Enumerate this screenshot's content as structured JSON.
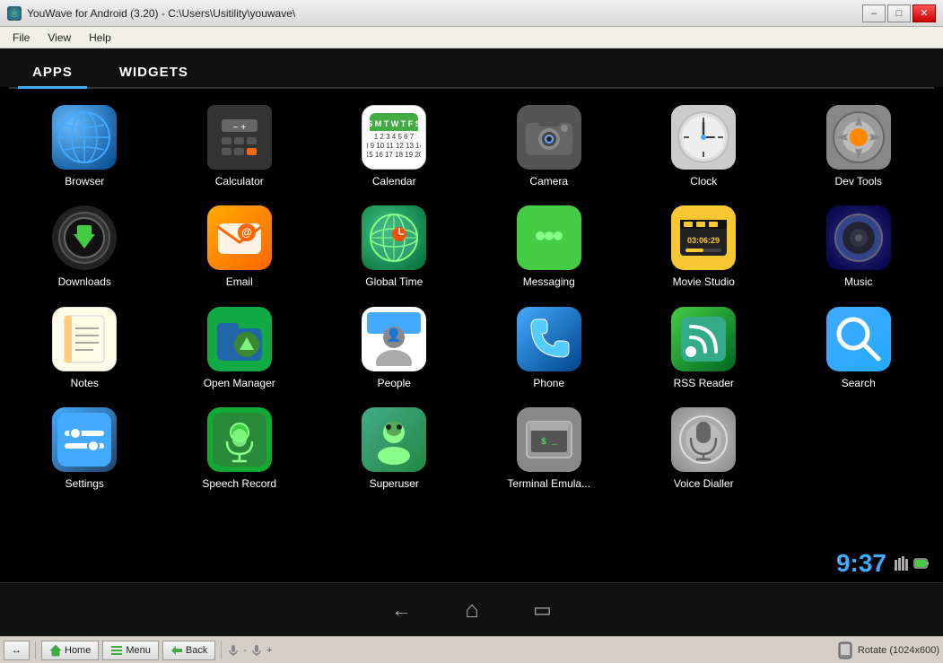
{
  "window": {
    "title": "YouWave for Android (3.20) - C:\\Users\\Usitility\\youwave\\",
    "icon": "youwave-icon"
  },
  "menu": {
    "items": [
      "File",
      "View",
      "Help"
    ]
  },
  "tabs": [
    {
      "label": "APPS",
      "active": true
    },
    {
      "label": "WIDGETS",
      "active": false
    }
  ],
  "apps": [
    {
      "name": "Browser",
      "icon": "browser"
    },
    {
      "name": "Calculator",
      "icon": "calculator"
    },
    {
      "name": "Calendar",
      "icon": "calendar"
    },
    {
      "name": "Camera",
      "icon": "camera"
    },
    {
      "name": "Clock",
      "icon": "clock"
    },
    {
      "name": "Dev Tools",
      "icon": "devtools"
    },
    {
      "name": "Downloads",
      "icon": "downloads"
    },
    {
      "name": "Email",
      "icon": "email"
    },
    {
      "name": "Global Time",
      "icon": "globaltime"
    },
    {
      "name": "Messaging",
      "icon": "messaging"
    },
    {
      "name": "Movie Studio",
      "icon": "movie"
    },
    {
      "name": "Music",
      "icon": "music"
    },
    {
      "name": "Notes",
      "icon": "notes"
    },
    {
      "name": "Open Manager",
      "icon": "openmanager"
    },
    {
      "name": "People",
      "icon": "people"
    },
    {
      "name": "Phone",
      "icon": "phone"
    },
    {
      "name": "RSS Reader",
      "icon": "rss"
    },
    {
      "name": "Search",
      "icon": "search"
    },
    {
      "name": "Settings",
      "icon": "settings"
    },
    {
      "name": "Speech Record",
      "icon": "speechrecord"
    },
    {
      "name": "Superuser",
      "icon": "superuser"
    },
    {
      "name": "Terminal Emula...",
      "icon": "terminal"
    },
    {
      "name": "Voice Dialler",
      "icon": "voicedialler"
    }
  ],
  "status": {
    "time": "9:37"
  },
  "nav": {
    "back": "←",
    "home": "⌂",
    "recent": "▭"
  },
  "toolbar": {
    "arrow_label": "↔",
    "home_label": "Home",
    "menu_label": "Menu",
    "back_label": "Back",
    "mic_label": "-",
    "mic2_label": "+",
    "rotate_label": "Rotate (1024x600)"
  }
}
